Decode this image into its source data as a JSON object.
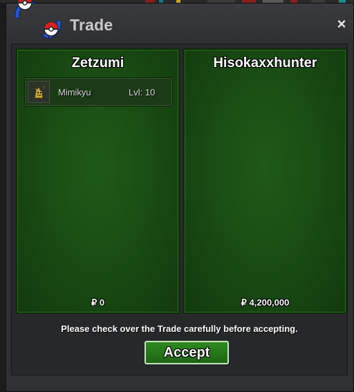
{
  "window": {
    "title": "Trade",
    "close_label": "×"
  },
  "panels": {
    "left": {
      "player_name": "Zetzumi",
      "money": "₽ 0",
      "items": [
        {
          "name": "Mimikyu",
          "level": "Lvl: 10",
          "icon": "mimikyu-sprite-icon"
        }
      ]
    },
    "right": {
      "player_name": "Hisokaxxhunter",
      "money": "₽ 4,200,000",
      "items": []
    }
  },
  "notice": "Please check over the Trade carefully before accepting.",
  "accept_label": "Accept",
  "colors": {
    "panel_green": "#1a4d14",
    "button_green": "#2f8a21",
    "window_bg": "#2f3033"
  }
}
